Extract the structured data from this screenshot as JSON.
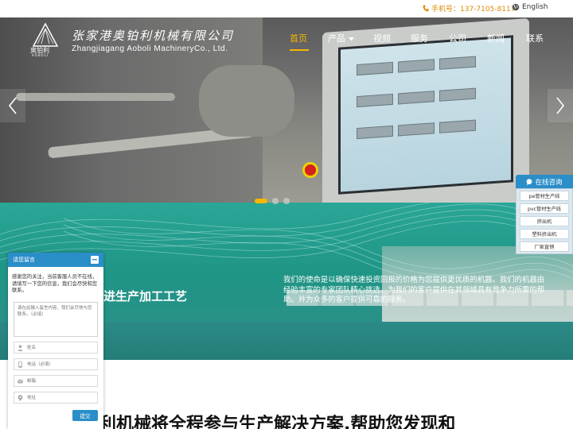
{
  "topbar": {
    "phone": "手机号：137-7105-8117",
    "language": "English"
  },
  "logo": {
    "cn_short": "奥铂利",
    "en_short": "AOBOLI"
  },
  "company": {
    "name_cn": "张家港奥铂利机械有限公司",
    "name_en": "Zhangjiagang Aoboli MachineryCo., Ltd."
  },
  "nav": {
    "items": [
      {
        "label": "首页",
        "active": true
      },
      {
        "label": "产品",
        "has_dropdown": true
      },
      {
        "label": "视频"
      },
      {
        "label": "服务"
      },
      {
        "label": "公司"
      },
      {
        "label": "新闻"
      },
      {
        "label": "联系"
      }
    ]
  },
  "slider": {
    "dot_count": 3,
    "active_index": 0
  },
  "section": {
    "slogan": "进生产加工工艺",
    "mission": "我们的使命是以确保快速投资回报的价格为您提供更优质的机器。我们的机器由经验丰富的专家团队精心挑选，为我们的客户提供在其领域具有竞争力所需的帮助。并为众多的客户提供可靠的服务。"
  },
  "heading": "奥铂利机械将全程参与生产解决方案,帮助您发现和",
  "float_panel": {
    "title": "在线咨询",
    "items": [
      "pe管材生产线",
      "pvc管材生产线",
      "挤出机",
      "塑料挤出机",
      "厂家直销"
    ]
  },
  "message_widget": {
    "title": "请您留言",
    "intro": "感谢您的关注，当前客服人员不在线，请填写一下您的信息，我们会尽快和您联系。",
    "textarea_placeholder": "请在此输入留言内容，我们会尽快与您联系。（必填）",
    "fields": [
      {
        "placeholder": "姓名"
      },
      {
        "placeholder": "电话（必填）"
      },
      {
        "placeholder": "邮箱"
      },
      {
        "placeholder": "地址"
      }
    ],
    "submit_label": "提交"
  },
  "colors": {
    "accent": "#f5b700",
    "phone": "#e08a00",
    "widget_blue": "#2a8ec9",
    "teal": "#2aa697"
  }
}
